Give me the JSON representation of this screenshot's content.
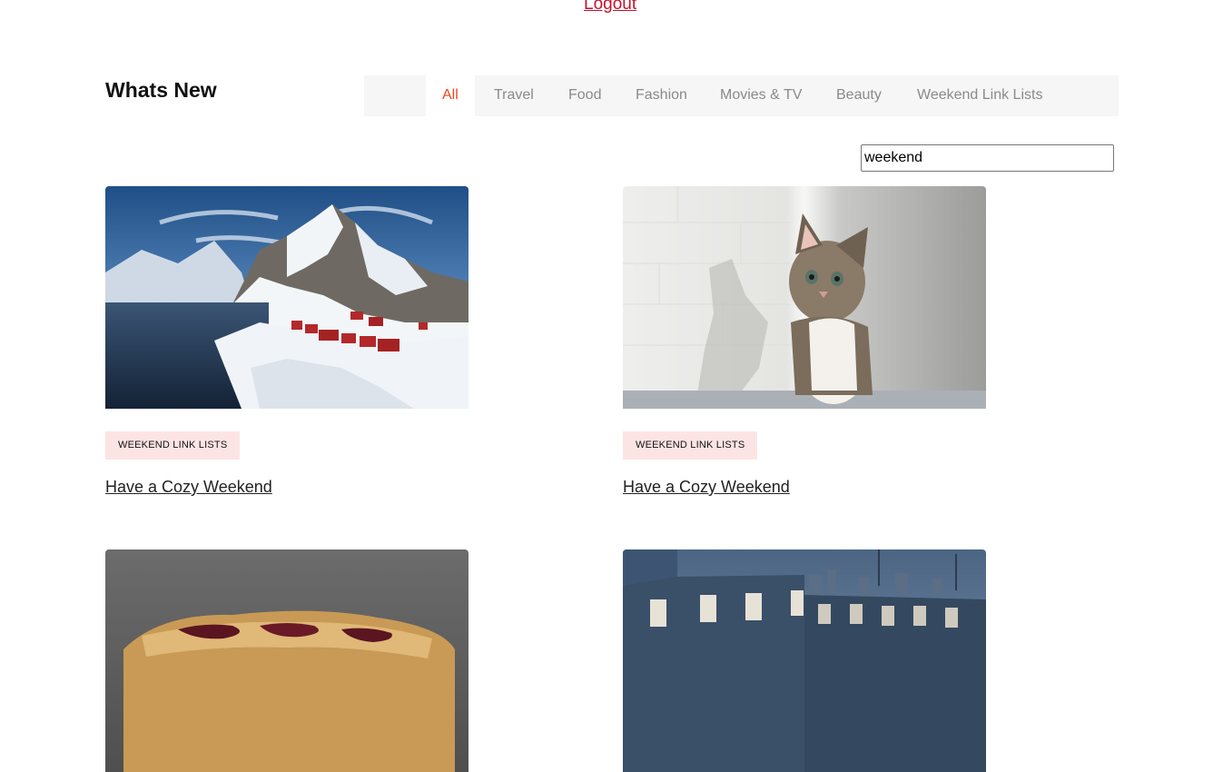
{
  "header": {
    "logout_label": "Logout"
  },
  "section": {
    "title": "Whats New"
  },
  "tabs": [
    {
      "label": "All",
      "active": true
    },
    {
      "label": "Travel",
      "active": false
    },
    {
      "label": "Food",
      "active": false
    },
    {
      "label": "Fashion",
      "active": false
    },
    {
      "label": "Movies & TV",
      "active": false
    },
    {
      "label": "Beauty",
      "active": false
    },
    {
      "label": "Weekend Link Lists",
      "active": false
    }
  ],
  "search": {
    "value": "weekend"
  },
  "posts": [
    {
      "image": "snowy-mountain-village-photo",
      "tag": "WEEKEND LINK LISTS",
      "title": "Have a Cozy Weekend"
    },
    {
      "image": "kitten-photo",
      "tag": "WEEKEND LINK LISTS",
      "title": "Have a Cozy Weekend"
    },
    {
      "image": "pie-photo",
      "tag": "",
      "title": ""
    },
    {
      "image": "rooftops-photo",
      "tag": "",
      "title": ""
    }
  ],
  "colors": {
    "accent": "#e8471c",
    "logout": "#c8102e",
    "tag_bg": "#fde4e4",
    "tab_bar_bg": "#f6f6f6"
  }
}
